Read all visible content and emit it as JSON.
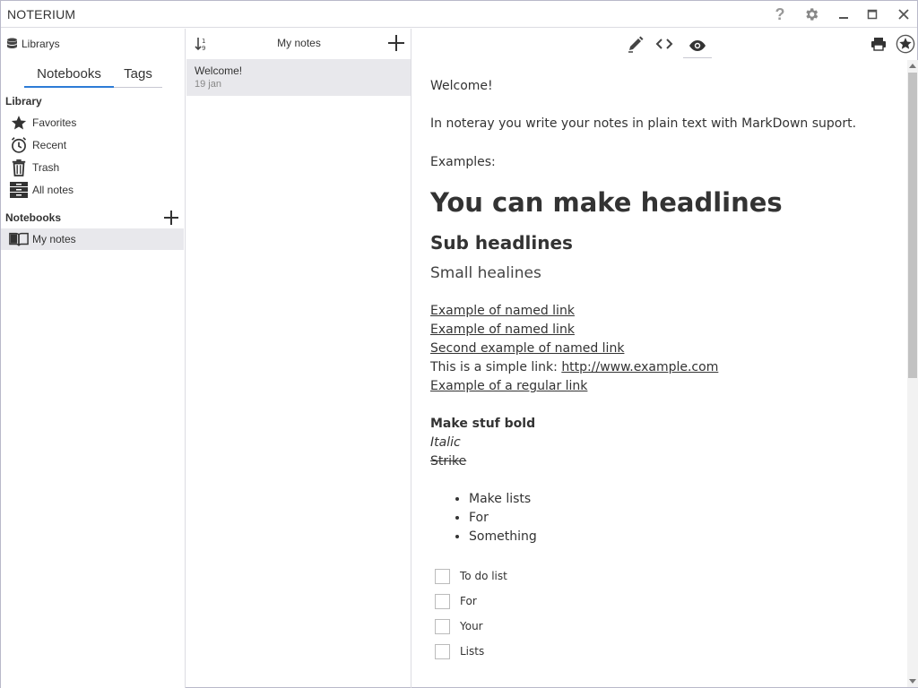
{
  "window": {
    "title": "NOTERIUM",
    "controls": {
      "help": "?",
      "minimize": "—",
      "maximize": "□",
      "close": "✕"
    }
  },
  "sidebar": {
    "library_header": "Librarys",
    "tabs": [
      {
        "label": "Notebooks",
        "active": true
      },
      {
        "label": "Tags",
        "active": false
      }
    ],
    "library_label": "Library",
    "library_items": [
      {
        "label": "Favorites",
        "icon": "star-icon"
      },
      {
        "label": "Recent",
        "icon": "clock-icon"
      },
      {
        "label": "Trash",
        "icon": "trash-icon"
      },
      {
        "label": "All notes",
        "icon": "archive-icon"
      }
    ],
    "notebooks_label": "Notebooks",
    "notebooks": [
      {
        "label": "My notes",
        "icon": "book-icon",
        "selected": true
      }
    ]
  },
  "note_list": {
    "title": "My notes",
    "notes": [
      {
        "title": "Welcome!",
        "date": "19 jan"
      }
    ]
  },
  "editor": {
    "modes": [
      "edit",
      "code",
      "preview"
    ],
    "active_mode": "preview",
    "content": {
      "welcome": "Welcome!",
      "intro": "In noteray you write your notes in plain text with MarkDown suport.",
      "examples": "Examples:",
      "h1": "You can make headlines",
      "h2": "Sub headlines",
      "h3": "Small healines",
      "links": [
        "Example of named link",
        "Example of named link",
        "Second example of named link"
      ],
      "simple_link_prefix": "This is a simple link: ",
      "simple_link_url": "http://www.example.com",
      "regular_link": "Example of a regular link",
      "bold": "Make stuf bold",
      "italic": "Italic",
      "strike": "Strike",
      "list": [
        "Make lists",
        "For",
        "Something"
      ],
      "todos": [
        "To do list",
        "For",
        "Your",
        "Lists"
      ]
    }
  },
  "colors": {
    "accent": "#2d7bd6",
    "selected_bg": "#e8e8ec",
    "border": "#dcdce2"
  }
}
